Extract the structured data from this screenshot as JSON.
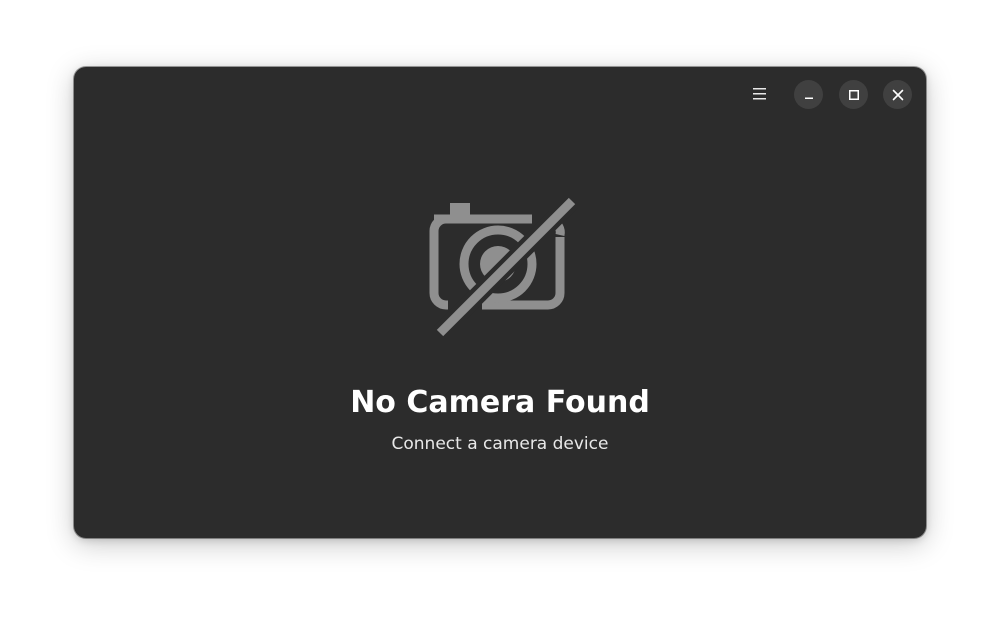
{
  "window": {
    "background": "#2c2c2c"
  },
  "headerbar": {
    "menu_icon": "hamburger-menu-icon",
    "minimize_icon": "minimize-icon",
    "maximize_icon": "maximize-icon",
    "close_icon": "close-icon"
  },
  "status": {
    "icon": "camera-disabled-icon",
    "title": "No Camera Found",
    "description": "Connect a camera device"
  },
  "colors": {
    "icon": "#8f8f8f",
    "title": "#ffffff",
    "description": "#e8e8e8",
    "button_bg": "#404040"
  }
}
